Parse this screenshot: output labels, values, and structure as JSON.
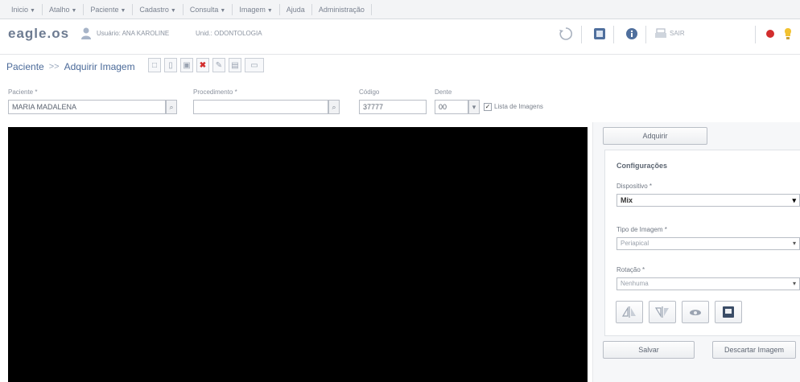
{
  "menu": {
    "items": [
      {
        "label": "Inicio",
        "has_dropdown": true
      },
      {
        "label": "Atalho",
        "has_dropdown": true
      },
      {
        "label": "Paciente",
        "has_dropdown": true
      },
      {
        "label": "Cadastro",
        "has_dropdown": true
      },
      {
        "label": "Consulta",
        "has_dropdown": true
      },
      {
        "label": "Imagem",
        "has_dropdown": true
      },
      {
        "label": "Ajuda",
        "has_dropdown": false
      },
      {
        "label": "Administração",
        "has_dropdown": false
      }
    ]
  },
  "header": {
    "brand": "eagle.os",
    "user_label": "Usuário: ANA KAROLINE",
    "unit_label": "Unid.: ODONTOLOGIA",
    "session_label": "SAIR",
    "icons": [
      "user-icon",
      "rotate-icon",
      "image-icon",
      "info-icon",
      "printer-icon",
      "record-icon",
      "lightbulb-icon"
    ]
  },
  "breadcrumb": {
    "parent": "Paciente",
    "current": "Adquirir Imagem"
  },
  "form": {
    "paciente": {
      "label": "Paciente *",
      "value": "MARIA MADALENA"
    },
    "procedimento": {
      "label": "Procedimento *",
      "value": ""
    },
    "codigo": {
      "label": "Código",
      "value": "37777"
    },
    "dente": {
      "label": "Dente",
      "value": "00"
    },
    "checkbox_label": "Lista de Imagens",
    "checkbox_checked": true
  },
  "right_panel": {
    "acquire_button": "Adquirir",
    "config_title": "Configurações",
    "fields": [
      {
        "label": "Dispositivo *",
        "value": "Mix",
        "strong": true
      },
      {
        "label": "Tipo de Imagem *",
        "value": "Periapical",
        "strong": false
      },
      {
        "label": "Rotação *",
        "value": "Nenhuma",
        "strong": false
      }
    ],
    "icon_buttons": [
      "flip-horizontal-icon",
      "flip-vertical-icon",
      "brightness-icon",
      "fullscreen-icon"
    ],
    "bottom_buttons": {
      "save": "Salvar",
      "discard": "Descartar Imagem"
    }
  },
  "colors": {
    "viewport": "#000000",
    "danger": "#d22d2d",
    "link": "#4b6a99"
  }
}
